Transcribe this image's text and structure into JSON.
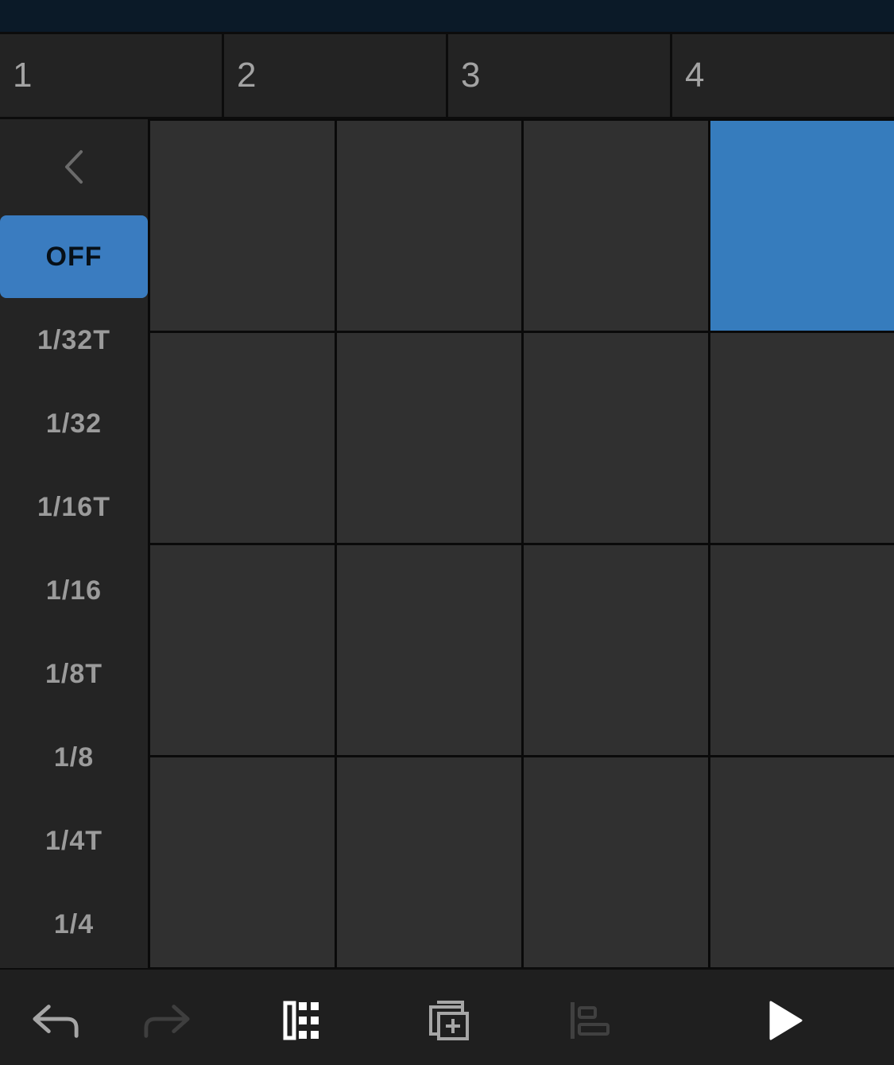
{
  "beats": [
    {
      "label": "1"
    },
    {
      "label": "2"
    },
    {
      "label": "3"
    },
    {
      "label": "4"
    }
  ],
  "sidebar": {
    "back_icon": "chevron-left-icon",
    "rates": [
      {
        "label": "OFF",
        "selected": true
      },
      {
        "label": "1/32T",
        "selected": false
      },
      {
        "label": "1/32",
        "selected": false
      },
      {
        "label": "1/16T",
        "selected": false
      },
      {
        "label": "1/16",
        "selected": false
      },
      {
        "label": "1/8T",
        "selected": false
      },
      {
        "label": "1/8",
        "selected": false
      },
      {
        "label": "1/4T",
        "selected": false
      },
      {
        "label": "1/4",
        "selected": false
      }
    ]
  },
  "grid": {
    "rows": 4,
    "cols": 4,
    "active_cells": [
      [
        0,
        3
      ]
    ]
  },
  "colors": {
    "accent": "#3a7cc0",
    "cell": "#303030",
    "background": "#212121"
  },
  "toolbar": {
    "icons": [
      "undo-icon",
      "redo-icon",
      "grid-pads-icon",
      "duplicate-add-icon",
      "align-icon",
      "play-icon"
    ]
  }
}
